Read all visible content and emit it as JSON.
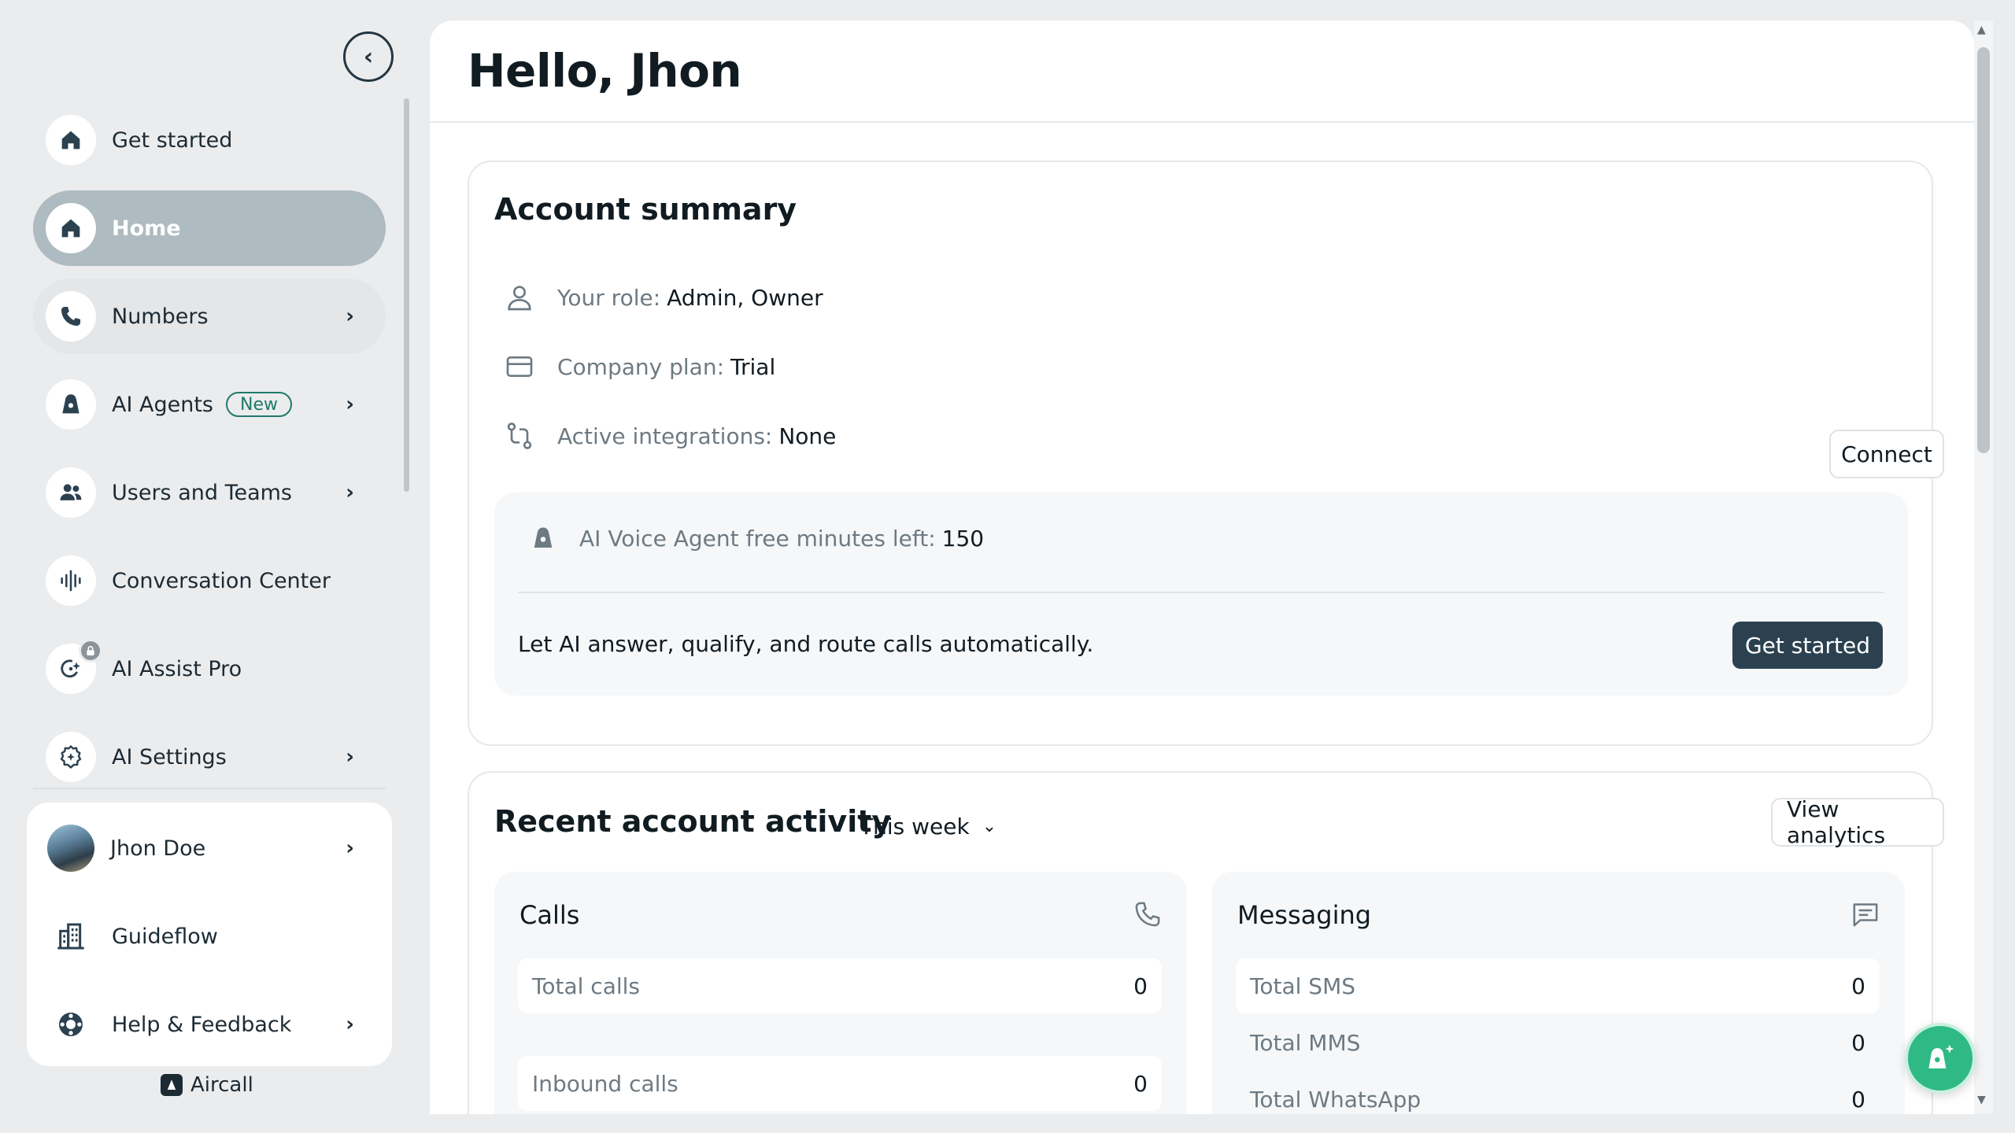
{
  "sidebar": {
    "collapse_icon": "chevron-left-icon",
    "items": [
      {
        "label": "Get started",
        "icon": "home-icon"
      },
      {
        "label": "Home",
        "icon": "home-icon",
        "active": true
      },
      {
        "label": "Numbers",
        "icon": "phone-icon"
      },
      {
        "label": "AI Agents",
        "icon": "ai-agent-icon",
        "badge": "New"
      },
      {
        "label": "Users and Teams",
        "icon": "users-icon"
      },
      {
        "label": "Conversation Center",
        "icon": "waveform-icon"
      },
      {
        "label": "AI Assist Pro",
        "icon": "ai-assist-icon",
        "locked": true
      },
      {
        "label": "AI Settings",
        "icon": "gear-sparkle-icon"
      }
    ],
    "user_panel": {
      "user_name": "Jhon Doe",
      "company": "Guideflow",
      "help": "Help & Feedback"
    },
    "brand": "Aircall"
  },
  "main": {
    "greeting": "Hello, Jhon",
    "summary": {
      "title": "Account summary",
      "role_key": "Your role:",
      "role_val": "Admin, Owner",
      "plan_key": "Company plan:",
      "plan_val": "Trial",
      "integrations_key": "Active integrations:",
      "integrations_val": "None",
      "connect_label": "Connect",
      "ai_minutes_key": "AI Voice Agent free minutes left:",
      "ai_minutes_val": "150",
      "ai_desc": "Let AI answer, qualify, and route calls automatically.",
      "get_started_label": "Get started"
    },
    "activity": {
      "title": "Recent account activity",
      "period": "This week",
      "view_analytics": "View analytics",
      "calls": {
        "title": "Calls",
        "rows": [
          {
            "label": "Total calls",
            "value": "0"
          },
          {
            "label": "Inbound calls",
            "value": "0"
          }
        ]
      },
      "messaging": {
        "title": "Messaging",
        "rows": [
          {
            "label": "Total SMS",
            "value": "0"
          },
          {
            "label": "Total MMS",
            "value": "0"
          },
          {
            "label": "Total WhatsApp",
            "value": "0"
          }
        ]
      }
    }
  },
  "colors": {
    "active_nav": "#aebbc0",
    "primary_dark": "#2c4150",
    "fab": "#2fb985",
    "badge": "#1f7a6a"
  }
}
